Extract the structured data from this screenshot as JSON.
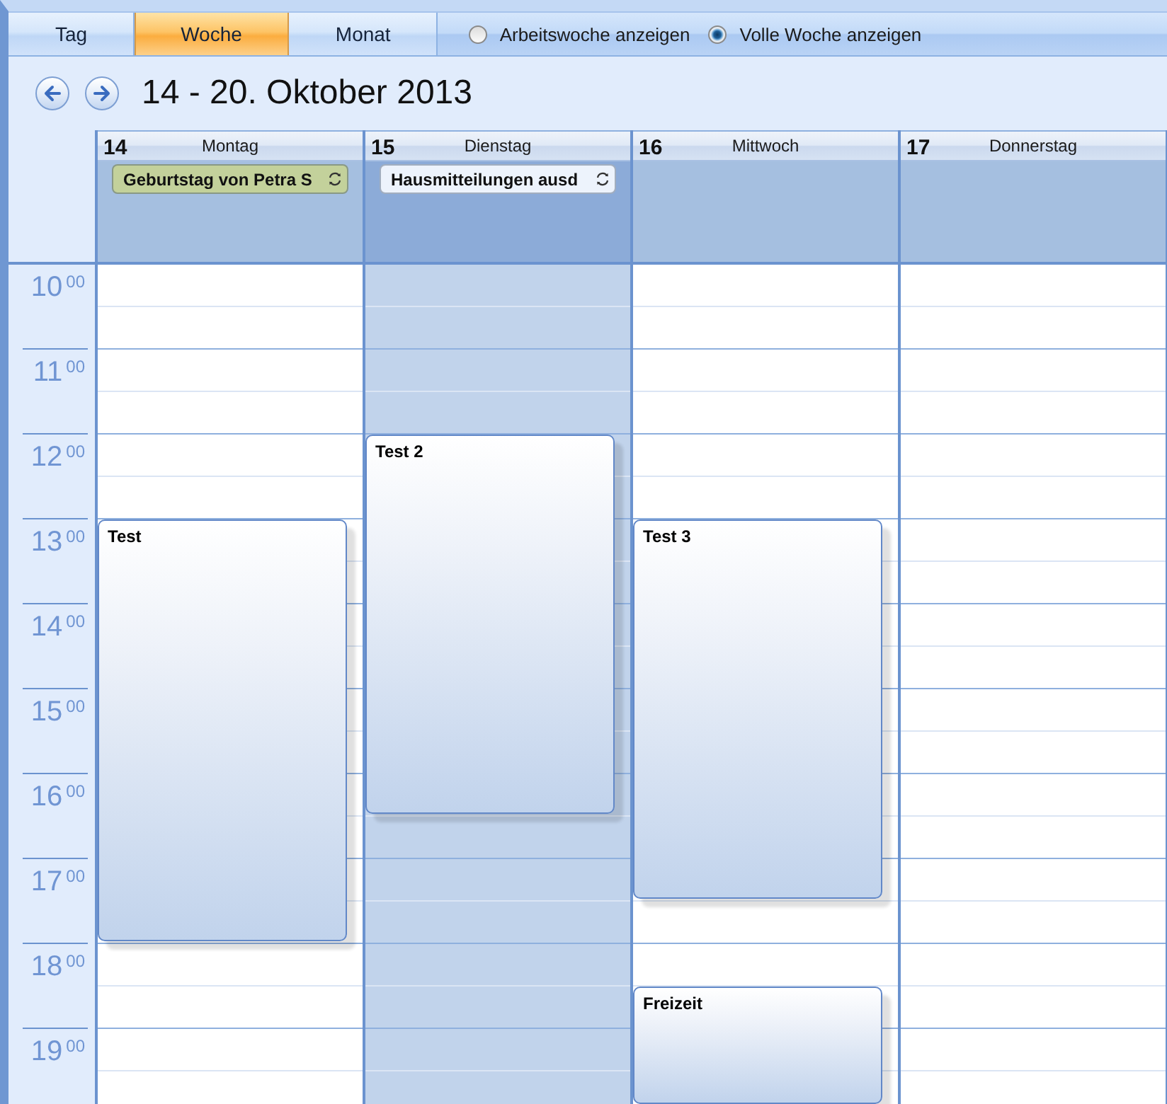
{
  "view_tabs": [
    {
      "label": "Tag",
      "selected": false
    },
    {
      "label": "Woche",
      "selected": true
    },
    {
      "label": "Monat",
      "selected": false
    }
  ],
  "week_options": [
    {
      "label": "Arbeitswoche anzeigen",
      "selected": false
    },
    {
      "label": "Volle Woche anzeigen",
      "selected": true
    }
  ],
  "date_range": "14 - 20. Oktober 2013",
  "hours": [
    {
      "hour": "10",
      "minutes": "00"
    },
    {
      "hour": "11",
      "minutes": "00"
    },
    {
      "hour": "12",
      "minutes": "00"
    },
    {
      "hour": "13",
      "minutes": "00"
    },
    {
      "hour": "14",
      "minutes": "00"
    },
    {
      "hour": "15",
      "minutes": "00"
    },
    {
      "hour": "16",
      "minutes": "00"
    },
    {
      "hour": "17",
      "minutes": "00"
    },
    {
      "hour": "18",
      "minutes": "00"
    },
    {
      "hour": "19",
      "minutes": "00"
    }
  ],
  "days": [
    {
      "number": "14",
      "name": "Montag",
      "selected": false,
      "all_day_events": [
        {
          "title": "Geburtstag von Petra S",
          "color": "#c3d19b",
          "recurring": true
        }
      ],
      "events": [
        {
          "title": "Test"
        }
      ]
    },
    {
      "number": "15",
      "name": "Dienstag",
      "selected": true,
      "all_day_events": [
        {
          "title": "Hausmitteilungen ausd",
          "color": "#edf3fc",
          "recurring": true
        }
      ],
      "events": [
        {
          "title": "Test 2"
        }
      ]
    },
    {
      "number": "16",
      "name": "Mittwoch",
      "selected": false,
      "events": [
        {
          "title": "Test 3"
        },
        {
          "title": "Freizeit"
        }
      ]
    },
    {
      "number": "17",
      "name": "Donnerstag",
      "selected": false
    }
  ]
}
